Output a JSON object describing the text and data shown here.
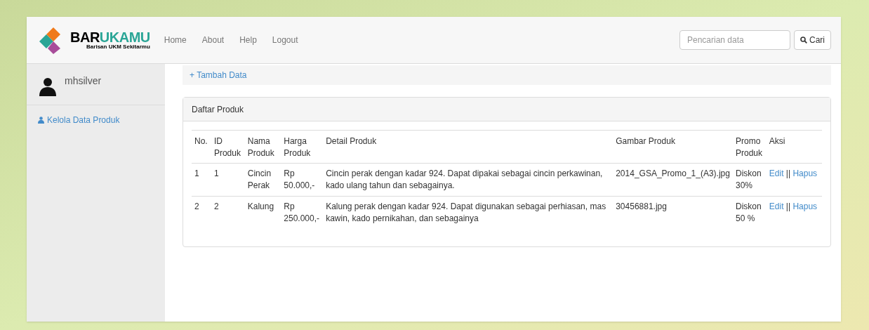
{
  "logo": {
    "name_parts": [
      "BAR",
      "UKAMU"
    ],
    "tagline": "Barisan UKM Sekitarmu"
  },
  "nav": [
    "Home",
    "About",
    "Help",
    "Logout"
  ],
  "search": {
    "placeholder": "Pencarian data",
    "button": "Cari"
  },
  "sidebar": {
    "user": "mhsilver",
    "items": [
      {
        "label": "Kelola Data Produk"
      }
    ]
  },
  "add_link": "+ Tambah Data",
  "panel": {
    "title": "Daftar Produk",
    "columns": [
      "No.",
      "ID Produk",
      "Nama Produk",
      "Harga Produk",
      "Detail Produk",
      "Gambar Produk",
      "Promo Produk",
      "Aksi"
    ],
    "rows": [
      {
        "cells": [
          "1",
          "1",
          "Cincin Perak",
          "Rp 50.000,-",
          "Cincin perak dengan kadar 924. Dapat dipakai sebagai cincin perkawinan, kado ulang tahun dan sebagainya.",
          "2014_GSA_Promo_1_(A3).jpg",
          "Diskon 30%"
        ],
        "actions": [
          "Edit",
          "||",
          "Hapus"
        ]
      },
      {
        "cells": [
          "2",
          "2",
          "Kalung",
          "Rp 250.000,-",
          "Kalung perak dengan kadar 924. Dapat digunakan sebagai perhiasan, mas kawin, kado pernikahan, dan sebagainya",
          "30456881.jpg",
          "Diskon 50 %"
        ],
        "actions": [
          "Edit",
          "||",
          "Hapus"
        ]
      }
    ]
  }
}
